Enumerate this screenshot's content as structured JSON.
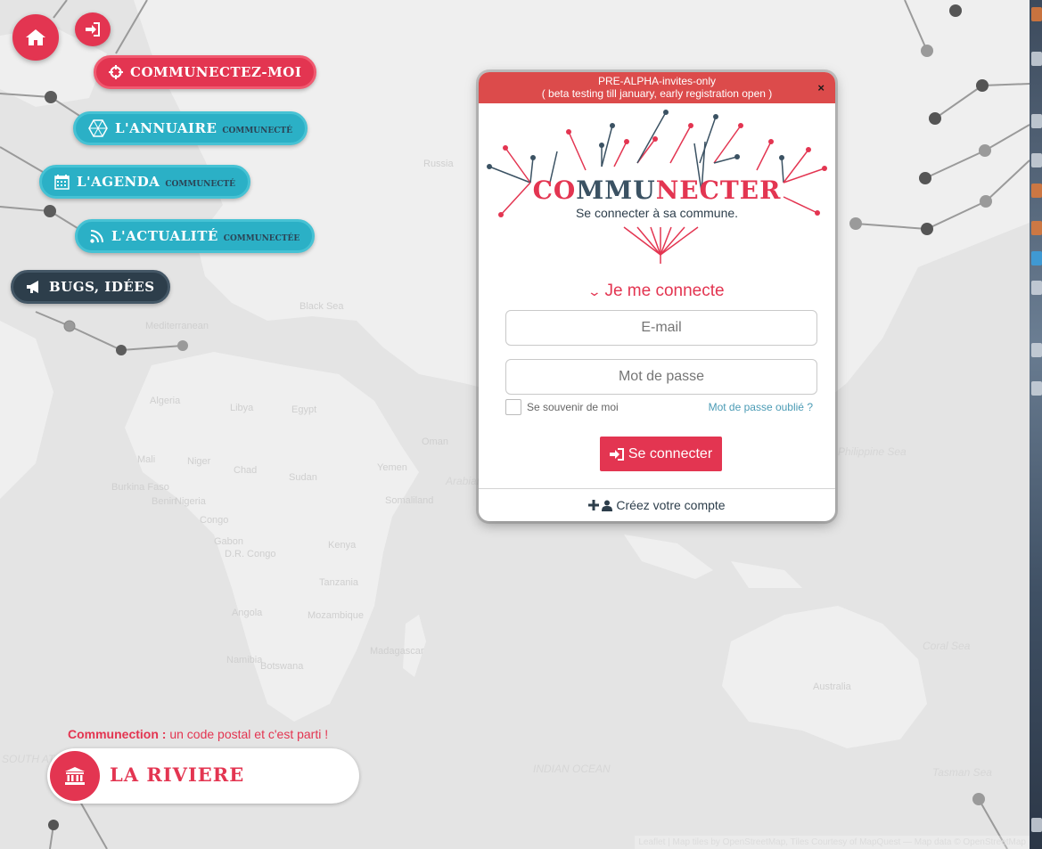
{
  "map": {
    "labels": [
      "Russia",
      "Black Sea",
      "Mediterranean",
      "Libya",
      "Egypt",
      "Algeria",
      "Niger",
      "Chad",
      "Sudan",
      "Mali",
      "Burkina Faso",
      "Benin",
      "Nigeria",
      "Gabon",
      "Congo",
      "D.R. Congo",
      "Angola",
      "Namibia",
      "Botswana",
      "Kenya",
      "Tanzania",
      "Madagascar",
      "Mozambique",
      "Yemen",
      "Somaliland",
      "Oman",
      "Arabian Sea",
      "Philippine Sea",
      "Coral Sea",
      "Tasman Sea",
      "Australia"
    ],
    "ocean_labels": [
      "INDIAN OCEAN",
      "SOUTH ATLANTIC OCEAN"
    ],
    "attribution": "Leaflet | Map tiles by OpenStreetMap, Tiles Courtesy of MapQuest — Map data © OpenStreetMap"
  },
  "nav": {
    "home": {
      "icon": "home-icon"
    },
    "login": {
      "icon": "sign-in-icon"
    },
    "items": [
      {
        "label": "COMMUNECTEZ-MOI",
        "sub": "",
        "icon": "crosshairs-icon",
        "color": "#e33551"
      },
      {
        "label": "L'ANNUAIRE",
        "sub": "COMMUNECTÉ",
        "icon": "hexagon-icon",
        "color": "#2bb0c6"
      },
      {
        "label": "L'AGENDA",
        "sub": "COMMUNECTÉ",
        "icon": "calendar-icon",
        "color": "#2bb0c6"
      },
      {
        "label": "L'ACTUALITÉ",
        "sub": "COMMUNECTÉE",
        "icon": "rss-icon",
        "color": "#2bb0c6"
      },
      {
        "label": "BUGS, IDÉES",
        "sub": "",
        "icon": "bullhorn-icon",
        "color": "#2d3e4b"
      }
    ]
  },
  "modal": {
    "banner_line1": "PRE-ALPHA-invites-only",
    "banner_line2": "( beta testing till january, early registration open )",
    "close": "×",
    "logo": {
      "part1": "CO",
      "part2": "MMU",
      "part3": "NECTER"
    },
    "tagline": "Se connecter à sa commune.",
    "title": "Je me connecte",
    "email_placeholder": "E-mail",
    "password_placeholder": "Mot de passe",
    "remember_label": "Se souvenir de moi",
    "forgot_label": "Mot de passe oublié ?",
    "submit_label": "Se connecter",
    "create_account_label": "Créez votre compte"
  },
  "communection": {
    "label_bold": "Communection :",
    "label_rest": " un code postal et c'est parti !",
    "city": "LA RIVIERE"
  },
  "colors": {
    "accent": "#e33551",
    "teal": "#2bb0c6",
    "dark": "#2d3e4b",
    "banner": "#dc4b4b"
  }
}
